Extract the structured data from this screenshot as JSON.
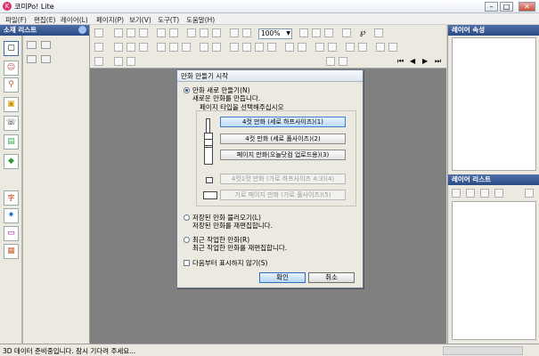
{
  "app": {
    "title": "코미Po! Lite",
    "icon": "komipo-app-icon",
    "window_buttons": [
      "minimize",
      "maximize",
      "close"
    ]
  },
  "menu": [
    {
      "label": "파일(F)"
    },
    {
      "label": "편집(E)"
    },
    {
      "label": "레이어(L)"
    },
    {
      "label": "페이지(P)"
    },
    {
      "label": "보기(V)"
    },
    {
      "label": "도구(T)"
    },
    {
      "label": "도움말(H)"
    }
  ],
  "left_panel": {
    "title": "소재 리스트",
    "tools": [
      {
        "icon": "select-frame-icon",
        "glyph": "▢"
      },
      {
        "icon": "character-icon",
        "glyph": "☺"
      },
      {
        "icon": "figure-pose-icon",
        "glyph": "⚲"
      },
      {
        "icon": "3d-object-icon",
        "glyph": "▣"
      },
      {
        "icon": "speech-balloon-icon",
        "glyph": "☏"
      },
      {
        "icon": "image-material-icon",
        "glyph": "▤"
      },
      {
        "icon": "background-cube-icon",
        "glyph": "◆"
      },
      {
        "icon": "text-material-icon",
        "glyph": "字"
      },
      {
        "icon": "effect-icon",
        "glyph": "✷"
      },
      {
        "icon": "frame-material-icon",
        "glyph": "▭"
      },
      {
        "icon": "scene-icon",
        "glyph": "▦"
      }
    ]
  },
  "toolbar": {
    "zoom_value": "100%",
    "page_indicator": "-- / --"
  },
  "right_panel": {
    "layer_properties_title": "레이어 속성",
    "layer_list_title": "레이어 리스트"
  },
  "status": {
    "message": "3D 데이터 준비중입니다. 잠시 기다려 주세요..."
  },
  "dialog": {
    "title": "만화 만들기 시작",
    "new_option": {
      "label": "만화 새로 만들기(N)",
      "desc": "새로운 만화를 만듭니다.",
      "selected": true
    },
    "page_type_prompt": "페이지 타입을 선택해주십시오",
    "page_types": [
      {
        "label": "4컷 만화 (세로 하프사이즈)(1)",
        "state": "selected"
      },
      {
        "label": "4컷 만화 (세로 풀사이즈)(2)",
        "state": "normal"
      },
      {
        "label": "페이지 만화(오늘닷컴 업로드용)(3)",
        "state": "normal"
      },
      {
        "label": "4컷1컷 만화 (가로 하프사이즈 4:3)(4)",
        "state": "disabled"
      },
      {
        "label": "가로 페이지 만화 (가로 풀사이즈)(5)",
        "state": "disabled"
      }
    ],
    "load_option": {
      "label": "저장된 만화 불러오기(L)",
      "desc": "저장된 만화를 재편집합니다.",
      "selected": false
    },
    "recent_option": {
      "label": "최근 작업한 만화(R)",
      "desc": "최근 작업한 만화를 재편집합니다.",
      "selected": false
    },
    "dont_show_label": "다음부터 표시하지 않기(S)",
    "dont_show_checked": false,
    "ok_label": "확인",
    "cancel_label": "취소"
  }
}
